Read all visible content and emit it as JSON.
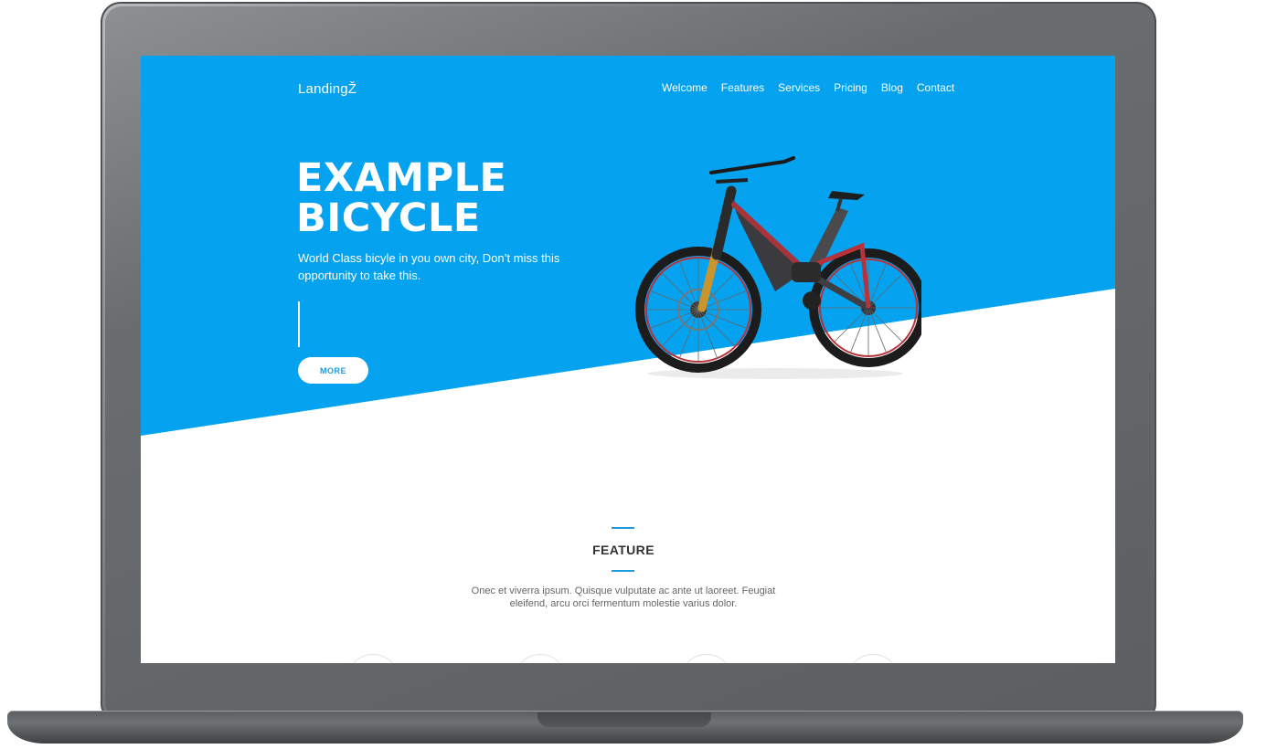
{
  "site": {
    "logo": "LandingŽ",
    "nav": [
      "Welcome",
      "Features",
      "Services",
      "Pricing",
      "Blog",
      "Contact"
    ]
  },
  "hero": {
    "title_line1": "EXAMPLE",
    "title_line2": "BICYCLE",
    "text": "World Class bicyle in you own city, Don’t miss this opportunity to take this.",
    "button": "MORE"
  },
  "feature": {
    "title": "FEATURE",
    "text": "Onec et viverra ipsum. Quisque vulputate ac ante ut laoreet. Feugiat eleifend, arcu orci fermentum molestie varius dolor."
  },
  "colors": {
    "accent": "#04a2ef",
    "accent_dark": "#1e9be0",
    "frame": "#5f6264"
  },
  "icons": [
    "bicycle-image",
    "feature-icon"
  ]
}
